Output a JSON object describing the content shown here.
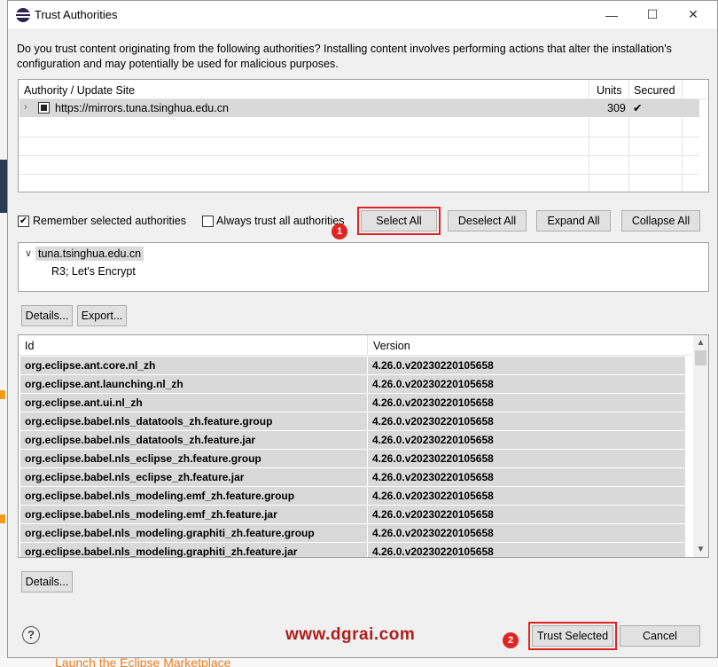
{
  "dialog": {
    "title": "Trust Authorities",
    "intro": "Do you trust content originating from the following authorities?  Installing content involves performing actions that alter the installation's configuration and may potentially be used for malicious purposes."
  },
  "authorities_table": {
    "headers": [
      "Authority / Update Site",
      "Units",
      "Secured"
    ],
    "rows": [
      {
        "site": "https://mirrors.tuna.tsinghua.edu.cn",
        "units": "309",
        "secured": "✔"
      }
    ]
  },
  "options": {
    "remember_label": "Remember selected authorities",
    "remember_checked": "✔",
    "always_trust_label": "Always trust all authorities"
  },
  "buttons": {
    "select_all": "Select All",
    "deselect_all": "Deselect All",
    "expand_all": "Expand All",
    "collapse_all": "Collapse All",
    "details": "Details...",
    "export": "Export...",
    "details2": "Details...",
    "trust_selected": "Trust Selected",
    "cancel": "Cancel"
  },
  "cert_tree": {
    "root": "tuna.tsinghua.edu.cn",
    "child": "R3; Let's Encrypt"
  },
  "units_table": {
    "headers": [
      "Id",
      "Version"
    ],
    "rows": [
      {
        "id": "org.eclipse.ant.core.nl_zh",
        "version": "4.26.0.v20230220105658"
      },
      {
        "id": "org.eclipse.ant.launching.nl_zh",
        "version": "4.26.0.v20230220105658"
      },
      {
        "id": "org.eclipse.ant.ui.nl_zh",
        "version": "4.26.0.v20230220105658"
      },
      {
        "id": "org.eclipse.babel.nls_datatools_zh.feature.group",
        "version": "4.26.0.v20230220105658"
      },
      {
        "id": "org.eclipse.babel.nls_datatools_zh.feature.jar",
        "version": "4.26.0.v20230220105658"
      },
      {
        "id": "org.eclipse.babel.nls_eclipse_zh.feature.group",
        "version": "4.26.0.v20230220105658"
      },
      {
        "id": "org.eclipse.babel.nls_eclipse_zh.feature.jar",
        "version": "4.26.0.v20230220105658"
      },
      {
        "id": "org.eclipse.babel.nls_modeling.emf_zh.feature.group",
        "version": "4.26.0.v20230220105658"
      },
      {
        "id": "org.eclipse.babel.nls_modeling.emf_zh.feature.jar",
        "version": "4.26.0.v20230220105658"
      },
      {
        "id": "org.eclipse.babel.nls_modeling.graphiti_zh.feature.group",
        "version": "4.26.0.v20230220105658"
      },
      {
        "id": "org.eclipse.babel.nls_modeling.graphiti_zh.feature.jar",
        "version": "4.26.0.v20230220105658"
      }
    ]
  },
  "annotations": {
    "badge1": "1",
    "badge2": "2",
    "accent": "#e02424"
  },
  "watermark": "www.dgrai.com",
  "background": {
    "marketplace_link": "Launch the Eclipse Marketplace"
  },
  "icons": {
    "help": "?",
    "minimize": "—",
    "maximize": "☐",
    "close": "✕"
  }
}
